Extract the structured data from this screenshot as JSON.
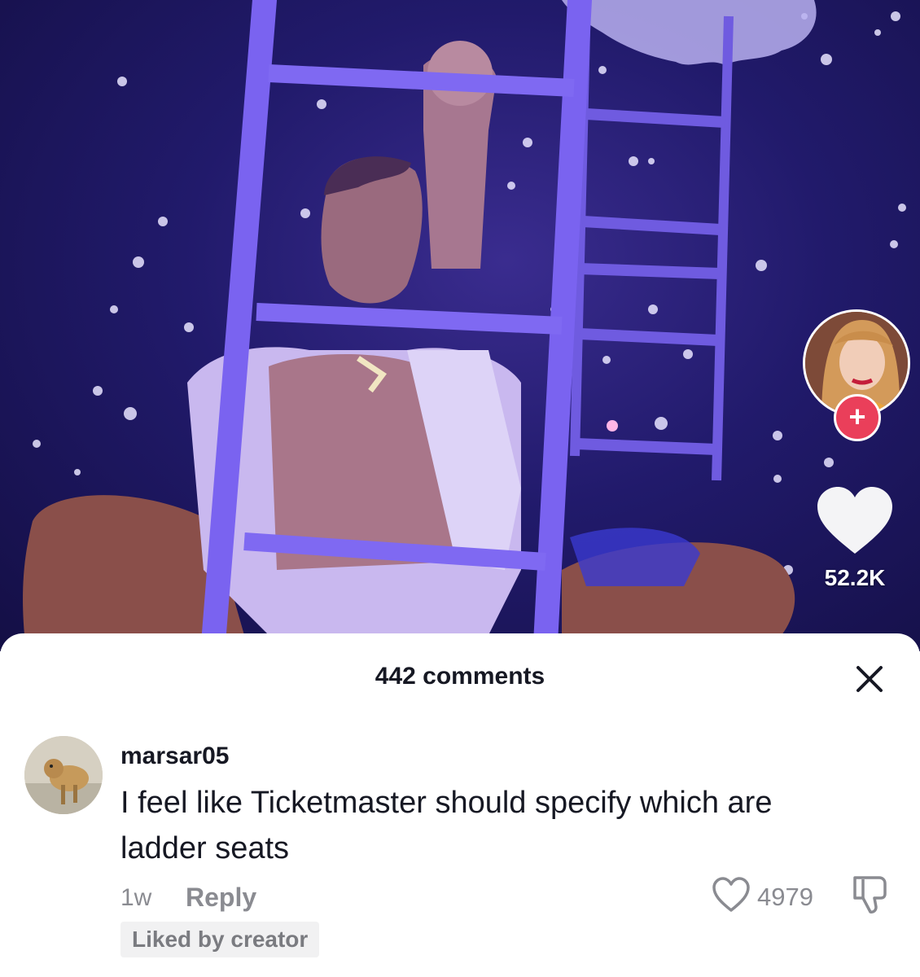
{
  "video": {
    "like_count": "52.2K",
    "follow_icon": "plus-icon",
    "like_icon": "heart-icon"
  },
  "comments_sheet": {
    "title": "442 comments",
    "close_icon": "close-icon"
  },
  "comment": {
    "username": "marsar05",
    "text_line1": "I feel like Ticketmaster should specify which are",
    "text_line2": "ladder seats",
    "time": "1w",
    "reply_label": "Reply",
    "like_count": "4979",
    "liked_badge": "Liked by creator"
  },
  "colors": {
    "follow_accent": "#ea3f5a",
    "text_primary": "#161823",
    "text_secondary": "#8a8b91"
  }
}
